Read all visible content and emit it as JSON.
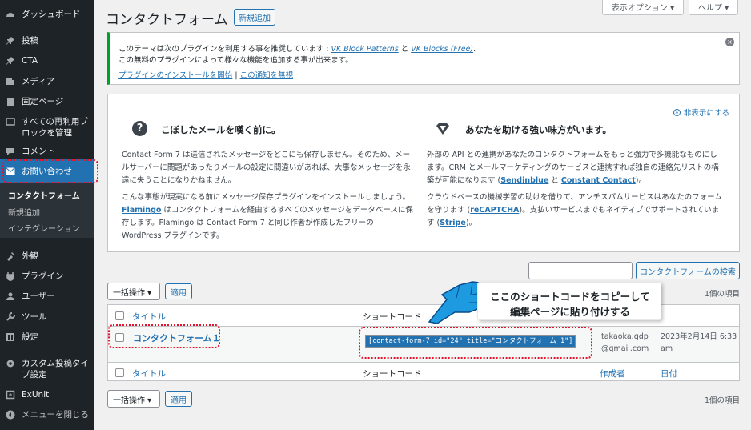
{
  "sidebar": {
    "items": [
      {
        "icon": "dashboard-icon",
        "label": "ダッシュボード"
      },
      {
        "icon": "pin-icon",
        "label": "投稿"
      },
      {
        "icon": "pin-icon",
        "label": "CTA"
      },
      {
        "icon": "media-icon",
        "label": "メディア"
      },
      {
        "icon": "page-icon",
        "label": "固定ページ"
      },
      {
        "icon": "reusable-block-icon",
        "label": "すべての再利用ブロックを管理"
      },
      {
        "icon": "comment-icon",
        "label": "コメント"
      },
      {
        "icon": "mail-icon",
        "label": "お問い合わせ"
      },
      {
        "icon": "appearance-icon",
        "label": "外観"
      },
      {
        "icon": "plugin-icon",
        "label": "プラグイン"
      },
      {
        "icon": "user-icon",
        "label": "ユーザー"
      },
      {
        "icon": "tool-icon",
        "label": "ツール"
      },
      {
        "icon": "settings-icon",
        "label": "設定"
      },
      {
        "icon": "gear-icon",
        "label": "カスタム投稿タイプ設定"
      },
      {
        "icon": "exunit-icon",
        "label": "ExUnit"
      },
      {
        "icon": "collapse-icon",
        "label": "メニューを閉じる"
      }
    ],
    "submenu": [
      "コンタクトフォーム",
      "新規追加",
      "インテグレーション"
    ]
  },
  "header": {
    "title": "コンタクトフォーム",
    "add_new": "新規追加",
    "screen_options": "表示オプション ▾",
    "help": "ヘルプ ▾"
  },
  "notice": {
    "line1_prefix": "このテーマは次のプラグインを利用する事を推奨しています : ",
    "plugin1": "VK Block Patterns",
    "and": " と ",
    "plugin2": "VK Blocks (Free)",
    "period": ".",
    "line2": "この無料のプラグインによって様々な機能を追加する事が出来ます。",
    "install_link": "プラグインのインストールを開始",
    "separator": " | ",
    "dismiss_link": "この通知を無視"
  },
  "welcome": {
    "hide_link": "非表示にする",
    "col1": {
      "heading": "こぼしたメールを嘆く前に。",
      "p1": "Contact Form 7 は送信されたメッセージをどこにも保存しません。そのため、メールサーバーに問題があったりメールの設定に間違いがあれば、大事なメッセージを永遠に失うことになりかねません。",
      "p2_link": "Flamingo",
      "p2_a": "こんな事態が現実になる前にメッセージ保存プラグインをインストールしましょう。",
      "p2_b": " はコンタクトフォームを経由するすべてのメッセージをデータベースに保存します。Flamingo は Contact Form 7 と同じ作者が作成したフリーの WordPress プラグインです。"
    },
    "col2": {
      "heading": "あなたを助ける強い味方がいます。",
      "p1_a": "外部の API との連携があなたのコンタクトフォームをもっと強力で多機能なものにします。CRM とメールマーケティングのサービスと連携すれば独自の連絡先リストの構築が可能になります (",
      "p1_link1": "Sendinblue",
      "p1_and": " と ",
      "p1_link2": "Constant Contact",
      "p1_b": ")。",
      "p2_a": "クラウドベースの機械学習の助けを借りて、アンチスパムサービスはあなたのフォームを守ります (",
      "p2_link1": "reCAPTCHA",
      "p2_b": ")。支払いサービスまでもネイティブでサポートされています (",
      "p2_link2": "Stripe",
      "p2_c": ")。"
    }
  },
  "search": {
    "placeholder": "",
    "button": "コンタクトフォームの検索"
  },
  "bulk": {
    "label": "一括操作 ▾",
    "apply": "適用",
    "count": "1個の項目"
  },
  "table": {
    "columns": {
      "title": "タイトル",
      "shortcode": "ショートコード",
      "author": "作成者",
      "date": "日付"
    },
    "row": {
      "title": "コンタクトフォーム１",
      "shortcode": "[contact-form-7 id=\"24\" title=\"コンタクトフォーム 1\"]",
      "author_line1": "takaoka.gdp",
      "author_line2": "@gmail.com",
      "date_line1": "2023年2月14日 6:33",
      "date_line2": "am"
    }
  },
  "callout": {
    "line1": "ここのショートコードをコピーして",
    "line2": "編集ページに貼り付けする"
  },
  "colors": {
    "sidebar": "#1d2327",
    "active": "#2271b1",
    "link": "#2271b1",
    "notice_border": "#00a32a",
    "annotation": "#e0132a",
    "arrow": "#1e9be0"
  }
}
